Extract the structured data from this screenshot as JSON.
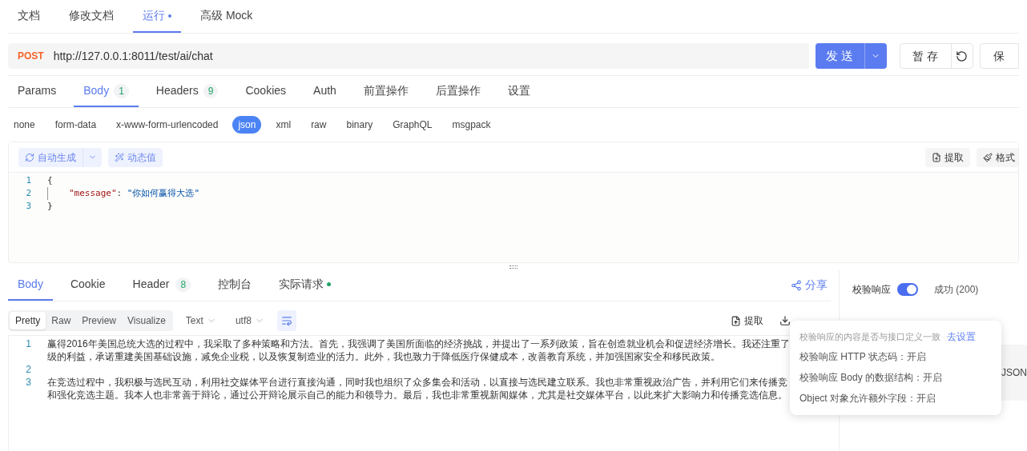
{
  "doc_tabs": [
    {
      "label": "文档",
      "selected": false,
      "dot": false
    },
    {
      "label": "修改文档",
      "selected": false,
      "dot": false
    },
    {
      "label": "运行",
      "selected": true,
      "dot": true
    },
    {
      "label": "高级 Mock",
      "selected": false,
      "dot": false
    }
  ],
  "request": {
    "method": "POST",
    "url": "http://127.0.0.1:8011/test/ai/chat",
    "send": "发 送",
    "stash": "暂 存",
    "save": "保"
  },
  "param_tabs": [
    {
      "label": "Params",
      "selected": false
    },
    {
      "label": "Body",
      "count": "1",
      "selected": true
    },
    {
      "label": "Headers",
      "count": "9",
      "selected": false
    },
    {
      "label": "Cookies",
      "selected": false
    },
    {
      "label": "Auth",
      "selected": false
    },
    {
      "label": "前置操作",
      "selected": false
    },
    {
      "label": "后置操作",
      "selected": false
    },
    {
      "label": "设置",
      "selected": false
    }
  ],
  "body_types": [
    {
      "label": "none",
      "selected": false
    },
    {
      "label": "form-data",
      "selected": false
    },
    {
      "label": "x-www-form-urlencoded",
      "selected": false
    },
    {
      "label": "json",
      "selected": true
    },
    {
      "label": "xml",
      "selected": false
    },
    {
      "label": "raw",
      "selected": false
    },
    {
      "label": "binary",
      "selected": false
    },
    {
      "label": "GraphQL",
      "selected": false
    },
    {
      "label": "msgpack",
      "selected": false
    }
  ],
  "editor": {
    "auto_generate": "自动生成",
    "dynamic_value": "动态值",
    "extract": "提取",
    "format": "格式",
    "lines": [
      {
        "number": "1",
        "tokens": [
          {
            "kind": "punct",
            "text": "{"
          }
        ]
      },
      {
        "number": "2",
        "tokens": [
          {
            "kind": "key",
            "text": "\"message\""
          },
          {
            "kind": "punct",
            "text": ": "
          },
          {
            "kind": "string",
            "text": "\"你如何赢得大选\""
          }
        ]
      },
      {
        "number": "3",
        "tokens": [
          {
            "kind": "punct",
            "text": "}"
          }
        ]
      }
    ]
  },
  "response_tabs": [
    {
      "label": "Body",
      "selected": true
    },
    {
      "label": "Cookie",
      "selected": false
    },
    {
      "label": "Header",
      "count": "8",
      "selected": false
    },
    {
      "label": "控制台",
      "selected": false
    },
    {
      "label": "实际请求",
      "selected": false,
      "dot": true
    }
  ],
  "share": "分享",
  "view_modes": [
    {
      "label": "Pretty",
      "selected": true
    },
    {
      "label": "Raw",
      "selected": false
    },
    {
      "label": "Preview",
      "selected": false
    },
    {
      "label": "Visualize",
      "selected": false
    }
  ],
  "content_type": "Text",
  "encoding": "utf8",
  "wrap_on": true,
  "extract": "提取",
  "response_lines": [
    {
      "number": "1",
      "text": [
        "赢得2016年美国总统大选的过程中，我采取了多种策略和方法。首先，我强调了美国所面临的经济挑战，并提出了一系列政策，旨在创造就业机会和促进经济增长。我还注重了",
        "级的利益，承诺重建美国基础设施，减免企业税，以及恢复制造业的活力。此外，我也致力于降低医疗保健成本，改善教育系统，并加强国家安全和移民政策。"
      ]
    },
    {
      "number": "2"
    },
    {
      "number": "3",
      "text": [
        "在竞选过程中，我积极与选民互动，利用社交媒体平台进行直接沟通，同时我也组织了众多集会和活动，以直接与选民建立联系。我也非常重视政治广告，并利用它们来传播竞",
        "和强化竞选主题。我本人也非常善于辩论，通过公开辩论展示自己的能力和领导力。最后，我也非常重视新闻媒体，尤其是社交媒体平台，以此来扩大影响力和传播竞选信息。"
      ]
    }
  ],
  "validation": {
    "label": "校验响应",
    "on": true,
    "status": "成功 (200)",
    "peek": "JSON"
  },
  "popover": {
    "intro": "校验响应的内容是否与接口定义一致",
    "link": "去设置",
    "items": [
      "校验响应 HTTP 状态码：开启",
      "校验响应 Body 的数据结构：开启",
      "Object 对象允许额外字段：开启"
    ]
  }
}
